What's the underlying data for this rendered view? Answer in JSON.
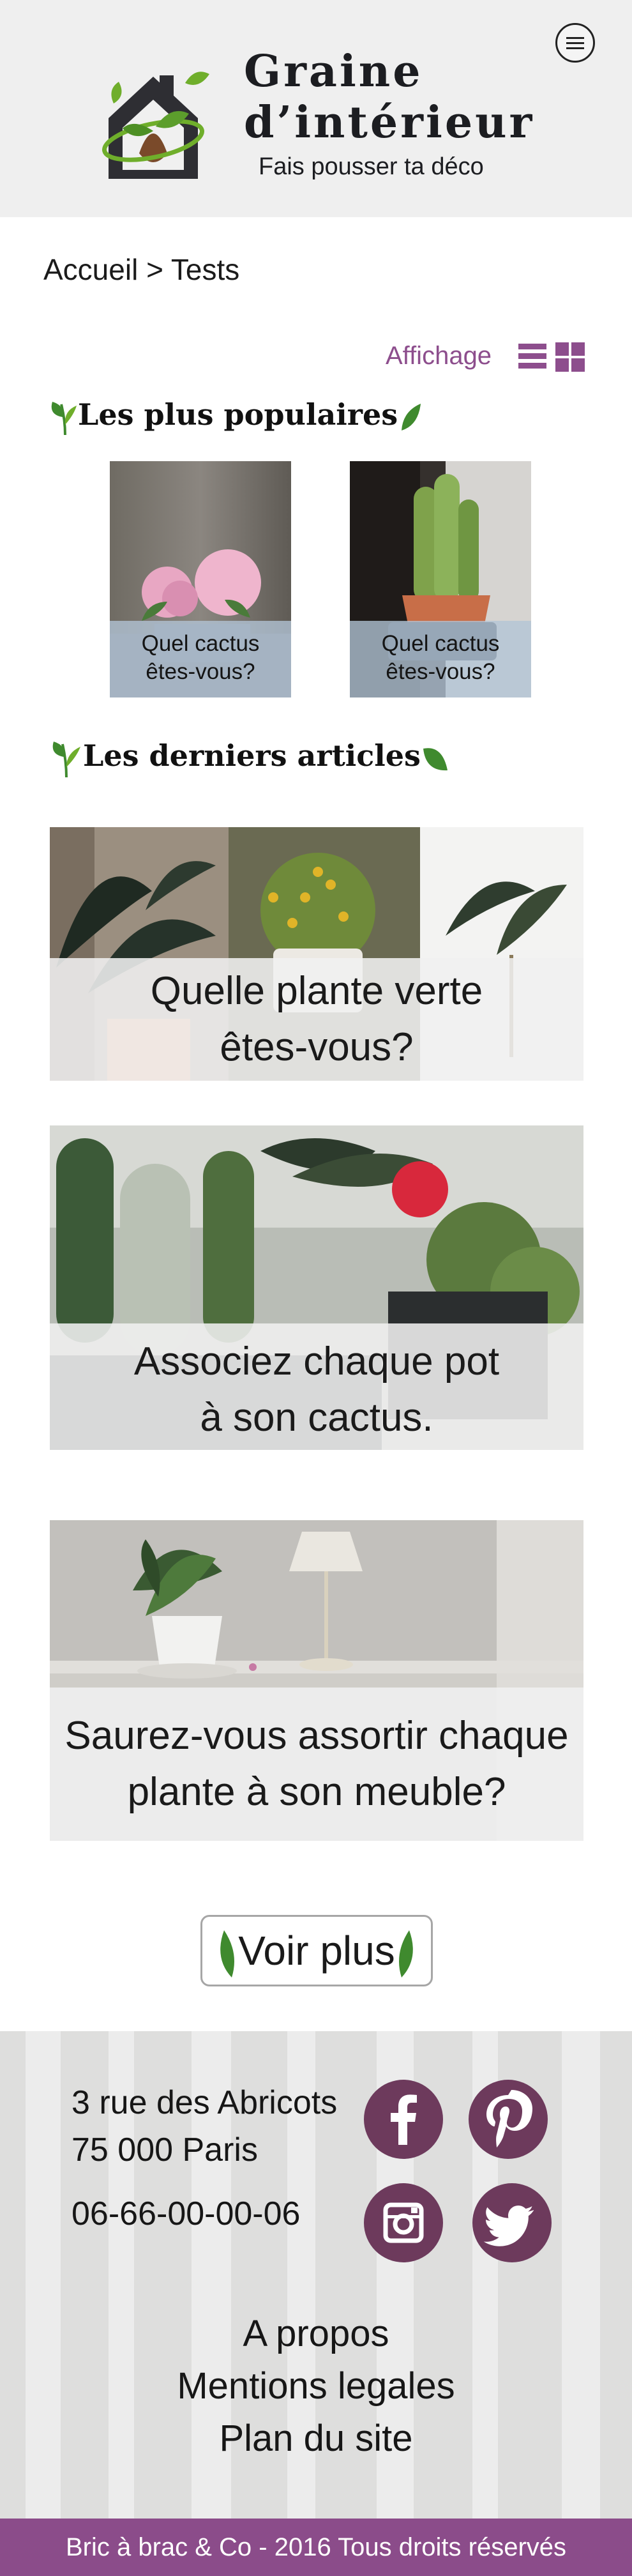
{
  "header": {
    "title_line1": "Graine",
    "title_line2": "d’intérieur",
    "tagline": "Fais pousser ta déco"
  },
  "breadcrumb": "Accueil > Tests",
  "display": {
    "label": "Affichage",
    "list_icon": "list-view-icon",
    "grid_icon": "grid-view-icon",
    "selected": "grid"
  },
  "popular": {
    "title": "Les plus populaires",
    "cards": [
      {
        "caption_line1": "Quel cactus",
        "caption_line2": "êtes-vous?"
      },
      {
        "caption_line1": "Quel cactus",
        "caption_line2": "êtes-vous?"
      }
    ]
  },
  "latest": {
    "title": "Les derniers articles",
    "articles": [
      {
        "line1": "Quelle plante verte",
        "line2": "êtes-vous?"
      },
      {
        "line1": "Associez chaque pot",
        "line2": "à son cactus."
      },
      {
        "line1": "Saurez-vous assortir chaque",
        "line2": "plante à son meuble?"
      }
    ]
  },
  "more_button": "Voir plus",
  "footer": {
    "address_line1": "3 rue des Abricots",
    "address_line2": "75 000 Paris",
    "phone": "06-66-00-00-06",
    "social": [
      "facebook-icon",
      "pinterest-icon",
      "instagram-icon",
      "twitter-icon"
    ],
    "links": [
      "A propos",
      "Mentions legales",
      "Plan du site"
    ],
    "copyright": "Bric à brac & Co - 2016 Tous droits réservés"
  },
  "colors": {
    "accent": "#8b4c8a",
    "social_bg": "#6d3a5c",
    "leaf_green": "#3f8a2e",
    "header_bg": "#efefef"
  }
}
